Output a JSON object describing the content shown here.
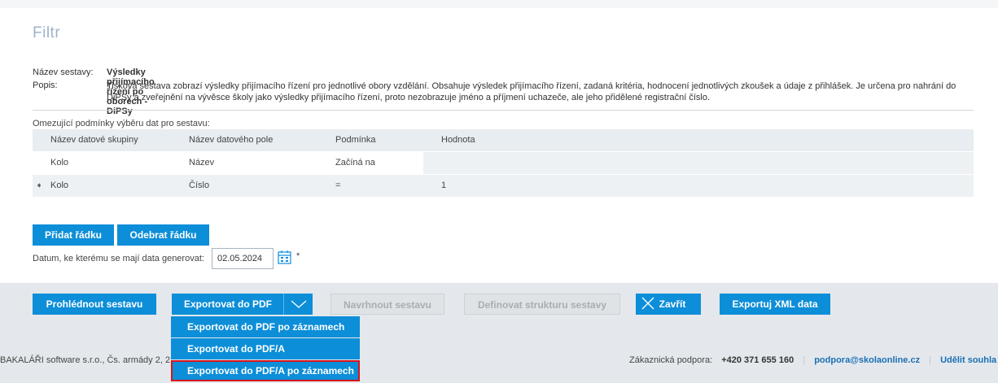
{
  "filter": {
    "title": "Filtr"
  },
  "report": {
    "name_label": "Název sestavy:",
    "name": "Výsledky přijímacího řízení po oborech - DiPSy",
    "desc_label": "Popis:",
    "desc": "Tisková sestava zobrazí výsledky přijímacího řízení pro jednotlivé obory vzdělání. Obsahuje výsledek přijímacího řízení, zadaná kritéria, hodnocení jednotlivých zkoušek a údaje z přihlášek. Je určena pro nahrání do DiPSy a zveřejnění na vývěsce školy jako výsledky přijímacího řízení, proto nezobrazuje jméno a příjmení uchazeče, ale jeho přidělené registrační číslo."
  },
  "conditions": {
    "title": "Omezující podmínky výběru dat pro sestavu:",
    "headers": [
      "Název datové skupiny",
      "Název datového pole",
      "Podmínka",
      "Hodnota"
    ],
    "rows": [
      [
        "Kolo",
        "Název",
        "Začíná na",
        ""
      ],
      [
        "Kolo",
        "Číslo",
        "=",
        "1"
      ]
    ],
    "current_row_marker": "➧"
  },
  "row_buttons": {
    "add": "Přidat řádku",
    "remove": "Odebrat řádku"
  },
  "date": {
    "label": "Datum, ke kterému se mají data generovat:",
    "value": "02.05.2024",
    "required_mark": "*"
  },
  "actions": {
    "preview": "Prohlédnout sestavu",
    "export_pdf": "Exportovat do PDF",
    "design": "Navrhnout sestavu",
    "define_structure": "Definovat strukturu sestavy",
    "close": "Zavřít",
    "export_xml": "Exportuj XML data"
  },
  "export_menu": [
    "Exportovat do PDF po záznamech",
    "Exportovat do PDF/A",
    "Exportovat do PDF/A po záznamech"
  ],
  "footer": {
    "company": "BAKALÁŘI software s.r.o., Čs. armády 2, 2",
    "support_label": "Zákaznická podpora:",
    "phone": "+420 371 655 160",
    "email": "podpora@skolaonline.cz",
    "consent": "Udělit souhla"
  },
  "colors": {
    "accent": "#0d8ed8",
    "highlight": "#d8141c",
    "bar": "#e4e8ec"
  },
  "icons": {
    "calendar": "calendar-icon",
    "chevron": "chevron-down-icon",
    "close": "close-icon",
    "row_marker": "row-pointer-icon"
  }
}
